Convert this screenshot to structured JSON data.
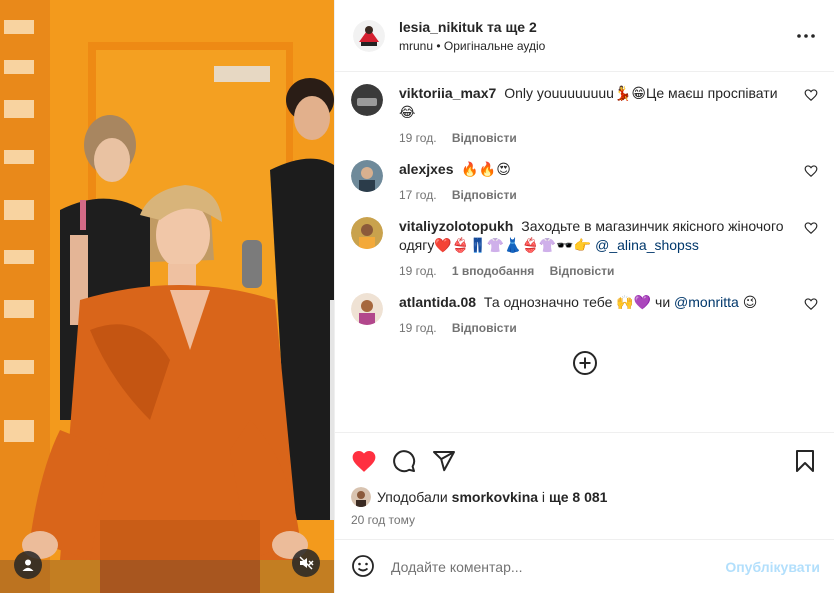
{
  "header": {
    "owner": "lesia_nikituk",
    "collab": "та ще 2",
    "sub_user": "mrunu",
    "audio": "Оригінальне аудіо",
    "sub_sep": "•"
  },
  "comments": [
    {
      "username": "viktoriia_max7",
      "text": "Only youuuuuuuu💃😁Це маєш проспівати 😂",
      "mention": "",
      "time": "19 год.",
      "likes": "",
      "reply": "Відповісти"
    },
    {
      "username": "alexjxes",
      "text": "🔥🔥😍",
      "mention": "",
      "time": "17 год.",
      "likes": "",
      "reply": "Відповісти"
    },
    {
      "username": "vitaliyzolotopukh",
      "text": "Заходьте в магазинчик якісного жіночого одягу❤️👙👖👚👗👙👚🕶️👉",
      "mention": "@_alina_shopss",
      "time": "19 год.",
      "likes": "1 вподобання",
      "reply": "Відповісти"
    },
    {
      "username": "atlantida.08",
      "text": "Та однозначно тебе 🙌💜 чи",
      "mention": "@monritta",
      "after_mention": " 😉",
      "time": "19 год.",
      "likes": "",
      "reply": "Відповісти"
    }
  ],
  "likes": {
    "prefix": "Уподобали",
    "user": "smorkovkina",
    "middle": "і",
    "count": "ще 8 081"
  },
  "time_ago": "20 год тому",
  "add_comment": {
    "placeholder": "Додайте коментар...",
    "publish": "Опублікувати"
  },
  "icons": {
    "like": "heart-filled-icon",
    "comment": "speech-bubble-icon",
    "share": "paper-plane-icon",
    "save": "bookmark-icon",
    "more": "more-dots-icon",
    "load_more": "plus-circle-icon",
    "emoji": "smiley-icon",
    "user_tag": "user-icon",
    "mute": "muted-speaker-icon"
  },
  "colors": {
    "like_red": "#ff3040",
    "mention_blue": "#00376b",
    "publish_disabled": "#b2dffc",
    "wall_orange": "#f08a12",
    "suit_orange": "#d9651a"
  }
}
